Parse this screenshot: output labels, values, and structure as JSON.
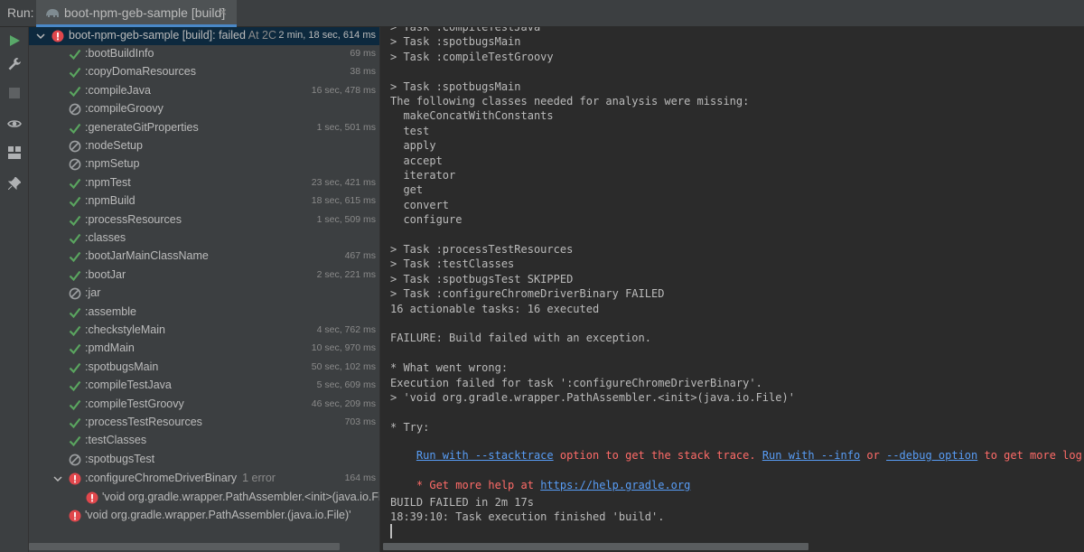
{
  "run_panel": {
    "label": "Run:",
    "tab_title": "boot-npm-geb-sample [build]",
    "tab_close": "×"
  },
  "toolbar": {
    "buttons": [
      "rerun-icon",
      "wrench-icon",
      "stop-icon",
      "eye-icon",
      "layout-icon",
      "pin-icon"
    ]
  },
  "tree": {
    "root": {
      "label": "boot-npm-geb-sample [build]:",
      "status": "failed",
      "status_suffix": "At 2C",
      "duration": "2 min, 18 sec, 614 ms"
    },
    "tasks": [
      {
        "name": ":bootBuildInfo",
        "status": "success",
        "duration": "69 ms"
      },
      {
        "name": ":copyDomaResources",
        "status": "success",
        "duration": "38 ms"
      },
      {
        "name": ":compileJava",
        "status": "success",
        "duration": "16 sec, 478 ms"
      },
      {
        "name": ":compileGroovy",
        "status": "skipped",
        "duration": ""
      },
      {
        "name": ":generateGitProperties",
        "status": "success",
        "duration": "1 sec, 501 ms"
      },
      {
        "name": ":nodeSetup",
        "status": "skipped",
        "duration": ""
      },
      {
        "name": ":npmSetup",
        "status": "skipped",
        "duration": ""
      },
      {
        "name": ":npmTest",
        "status": "success",
        "duration": "23 sec, 421 ms"
      },
      {
        "name": ":npmBuild",
        "status": "success",
        "duration": "18 sec, 615 ms"
      },
      {
        "name": ":processResources",
        "status": "success",
        "duration": "1 sec, 509 ms"
      },
      {
        "name": ":classes",
        "status": "success",
        "duration": ""
      },
      {
        "name": ":bootJarMainClassName",
        "status": "success",
        "duration": "467 ms"
      },
      {
        "name": ":bootJar",
        "status": "success",
        "duration": "2 sec, 221 ms"
      },
      {
        "name": ":jar",
        "status": "skipped",
        "duration": ""
      },
      {
        "name": ":assemble",
        "status": "success",
        "duration": ""
      },
      {
        "name": ":checkstyleMain",
        "status": "success",
        "duration": "4 sec, 762 ms"
      },
      {
        "name": ":pmdMain",
        "status": "success",
        "duration": "10 sec, 970 ms"
      },
      {
        "name": ":spotbugsMain",
        "status": "success",
        "duration": "50 sec, 102 ms"
      },
      {
        "name": ":compileTestJava",
        "status": "success",
        "duration": "5 sec, 609 ms"
      },
      {
        "name": ":compileTestGroovy",
        "status": "success",
        "duration": "46 sec, 209 ms"
      },
      {
        "name": ":processTestResources",
        "status": "success",
        "duration": "703 ms"
      },
      {
        "name": ":testClasses",
        "status": "success",
        "duration": ""
      },
      {
        "name": ":spotbugsTest",
        "status": "skipped",
        "duration": ""
      }
    ],
    "failed_task": {
      "name": ":configureChromeDriverBinary",
      "sub": "1 error",
      "duration": "164 ms"
    },
    "failed_child": "'void org.gradle.wrapper.PathAssembler.<init>(java.io.Fil",
    "root_error": "'void org.gradle.wrapper.PathAssembler.(java.io.File)'"
  },
  "console": {
    "lines": [
      {
        "text": "> Task :compileTestJava",
        "style": "normal"
      },
      {
        "text": "> Task :spotbugsMain",
        "style": "normal"
      },
      {
        "text": "> Task :compileTestGroovy",
        "style": "normal"
      },
      {
        "text": "",
        "style": "normal"
      },
      {
        "text": "> Task :spotbugsMain",
        "style": "normal"
      },
      {
        "text": "The following classes needed for analysis were missing:",
        "style": "red"
      },
      {
        "text": "  makeConcatWithConstants",
        "style": "red"
      },
      {
        "text": "  test",
        "style": "red"
      },
      {
        "text": "  apply",
        "style": "red"
      },
      {
        "text": "  accept",
        "style": "red"
      },
      {
        "text": "  iterator",
        "style": "red"
      },
      {
        "text": "  get",
        "style": "red"
      },
      {
        "text": "  convert",
        "style": "red"
      },
      {
        "text": "  configure",
        "style": "red"
      },
      {
        "text": "",
        "style": "normal"
      },
      {
        "text": "> Task :processTestResources",
        "style": "normal"
      },
      {
        "text": "> Task :testClasses",
        "style": "normal"
      },
      {
        "text": "> Task :spotbugsTest SKIPPED",
        "style": "normal"
      },
      {
        "text": "> Task :configureChromeDriverBinary FAILED",
        "style": "normal"
      },
      {
        "text": "16 actionable tasks: 16 executed",
        "style": "normal"
      },
      {
        "text": "",
        "style": "normal"
      },
      {
        "text": "FAILURE: Build failed with an exception.",
        "style": "red"
      },
      {
        "text": "",
        "style": "normal"
      },
      {
        "text": "* What went wrong:",
        "style": "red"
      },
      {
        "text": "Execution failed for task ':configureChromeDriverBinary'.",
        "style": "red"
      },
      {
        "text": "> 'void org.gradle.wrapper.PathAssembler.<init>(java.io.File)'",
        "style": "red"
      },
      {
        "text": "",
        "style": "normal"
      },
      {
        "text": "* Try:",
        "style": "red"
      }
    ],
    "try_line": {
      "link1": "Run with --stacktrace",
      "text1": " option to get the stack trace. ",
      "link2": "Run with --info",
      "text2": " or ",
      "link3": "--debug option",
      "text3": " to get more log o"
    },
    "help_line": {
      "prefix": "* Get more help at ",
      "link": "https://help.gradle.org"
    },
    "tail": [
      {
        "text": "BUILD FAILED in 2m 17s",
        "style": "red"
      },
      {
        "text": "18:39:10: Task execution finished 'build'.",
        "style": "normal"
      }
    ]
  },
  "colors": {
    "success": "#5aa55f",
    "skipped": "#9da0a2",
    "error": "#e0474c",
    "link": "#589df6",
    "error_text": "#ff6b68"
  }
}
